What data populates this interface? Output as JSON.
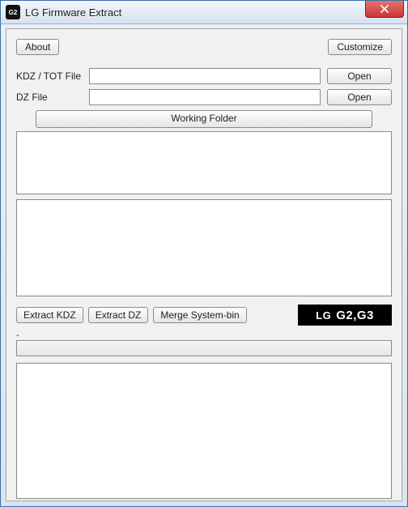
{
  "window": {
    "title": "LG Firmware Extract",
    "icon_text": "G2"
  },
  "toolbar": {
    "about_label": "About",
    "customize_label": "Customize"
  },
  "files": {
    "kdz_label": "KDZ / TOT File",
    "kdz_value": "",
    "kdz_open": "Open",
    "dz_label": "DZ File",
    "dz_value": "",
    "dz_open": "Open"
  },
  "working_folder_label": "Working Folder",
  "actions": {
    "extract_kdz": "Extract KDZ",
    "extract_dz": "Extract DZ",
    "merge_system": "Merge System-bin"
  },
  "logo": {
    "brand": "LG",
    "models": "G2,G3"
  },
  "status": {
    "tick": "-"
  }
}
